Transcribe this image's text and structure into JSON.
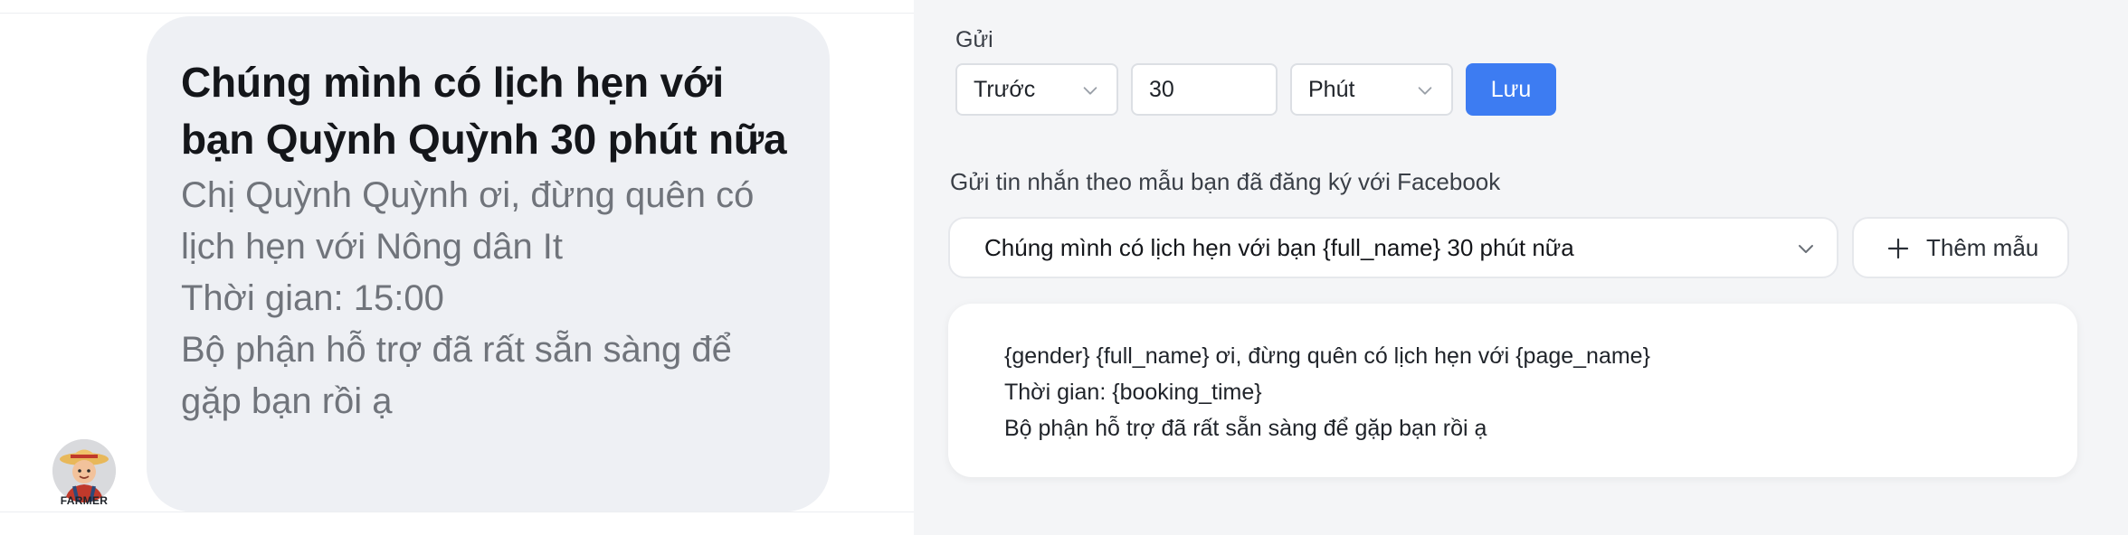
{
  "preview": {
    "title": "Chúng mình có lịch hẹn với bạn Quỳnh Quỳnh 30 phút nữa",
    "body": "Chị Quỳnh Quỳnh ơi, đừng quên có lịch hẹn với Nông dân It\nThời gian: 15:00\nBộ phận hỗ trợ đã rất sẵn sàng để gặp bạn rồi ạ",
    "avatar_caption": "FARMER"
  },
  "send": {
    "label": "Gửi",
    "timing": "Trước",
    "amount": "30",
    "unit": "Phút",
    "save_label": "Lưu"
  },
  "template": {
    "label": "Gửi tin nhắn theo mẫu bạn đã đăng ký với Facebook",
    "selected": "Chúng mình có lịch hẹn với bạn {full_name} 30 phút nữa",
    "add_label": "Thêm mẫu",
    "lines": [
      "{gender} {full_name} ơi, đừng quên có lịch hẹn với {page_name}",
      "Thời gian: {booking_time}",
      "Bộ phận hỗ trợ đã rất sẵn sàng để gặp bạn rồi ạ"
    ]
  },
  "colors": {
    "accent": "#3d7cf2",
    "bubble": "#eef0f4",
    "background": "#f4f5f7"
  },
  "icons": [
    "chevron-down-icon",
    "plus-icon",
    "farmer-avatar"
  ]
}
